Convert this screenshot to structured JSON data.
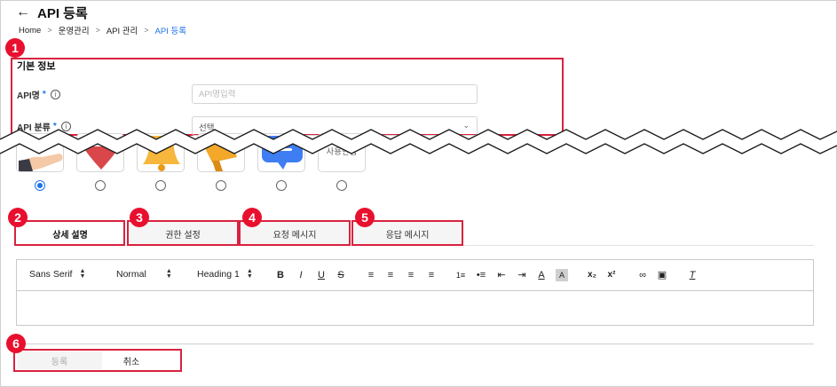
{
  "header": {
    "back_icon": "arrow-left-icon",
    "title": "API 등록",
    "breadcrumb": [
      "Home",
      "운영관리",
      "API 관리",
      "API 등록"
    ]
  },
  "basic_info": {
    "title": "기본 정보",
    "api_name": {
      "label": "API명",
      "required": "*",
      "placeholder": "API명입력",
      "value": ""
    },
    "api_category": {
      "label": "API 분류",
      "required": "*",
      "value": "선택"
    }
  },
  "icon_options": {
    "cards": [
      {
        "name": "hand-icon",
        "label": ""
      },
      {
        "name": "heart-icon",
        "label": ""
      },
      {
        "name": "bell-icon",
        "label": ""
      },
      {
        "name": "megaphone-icon",
        "label": ""
      },
      {
        "name": "chat-bubble-icon",
        "label": ""
      },
      {
        "name": "custom-upload-option",
        "label": "사용안함"
      }
    ],
    "selected_index": 0
  },
  "tabs": [
    {
      "label": "상세 설명",
      "active": true
    },
    {
      "label": "권한 설정",
      "active": false
    },
    {
      "label": "요청 메시지",
      "active": false
    },
    {
      "label": "응답 메시지",
      "active": false
    }
  ],
  "editor": {
    "font": "Sans Serif",
    "size": "Normal",
    "heading": "Heading 1",
    "format_buttons": [
      "B",
      "I",
      "U",
      "S"
    ],
    "content": ""
  },
  "actions": {
    "register": "등록",
    "cancel": "취소"
  },
  "callouts": [
    "1",
    "2",
    "3",
    "4",
    "5",
    "6"
  ],
  "colors": {
    "accent": "#1e73e8",
    "callout": "#e8102e"
  }
}
